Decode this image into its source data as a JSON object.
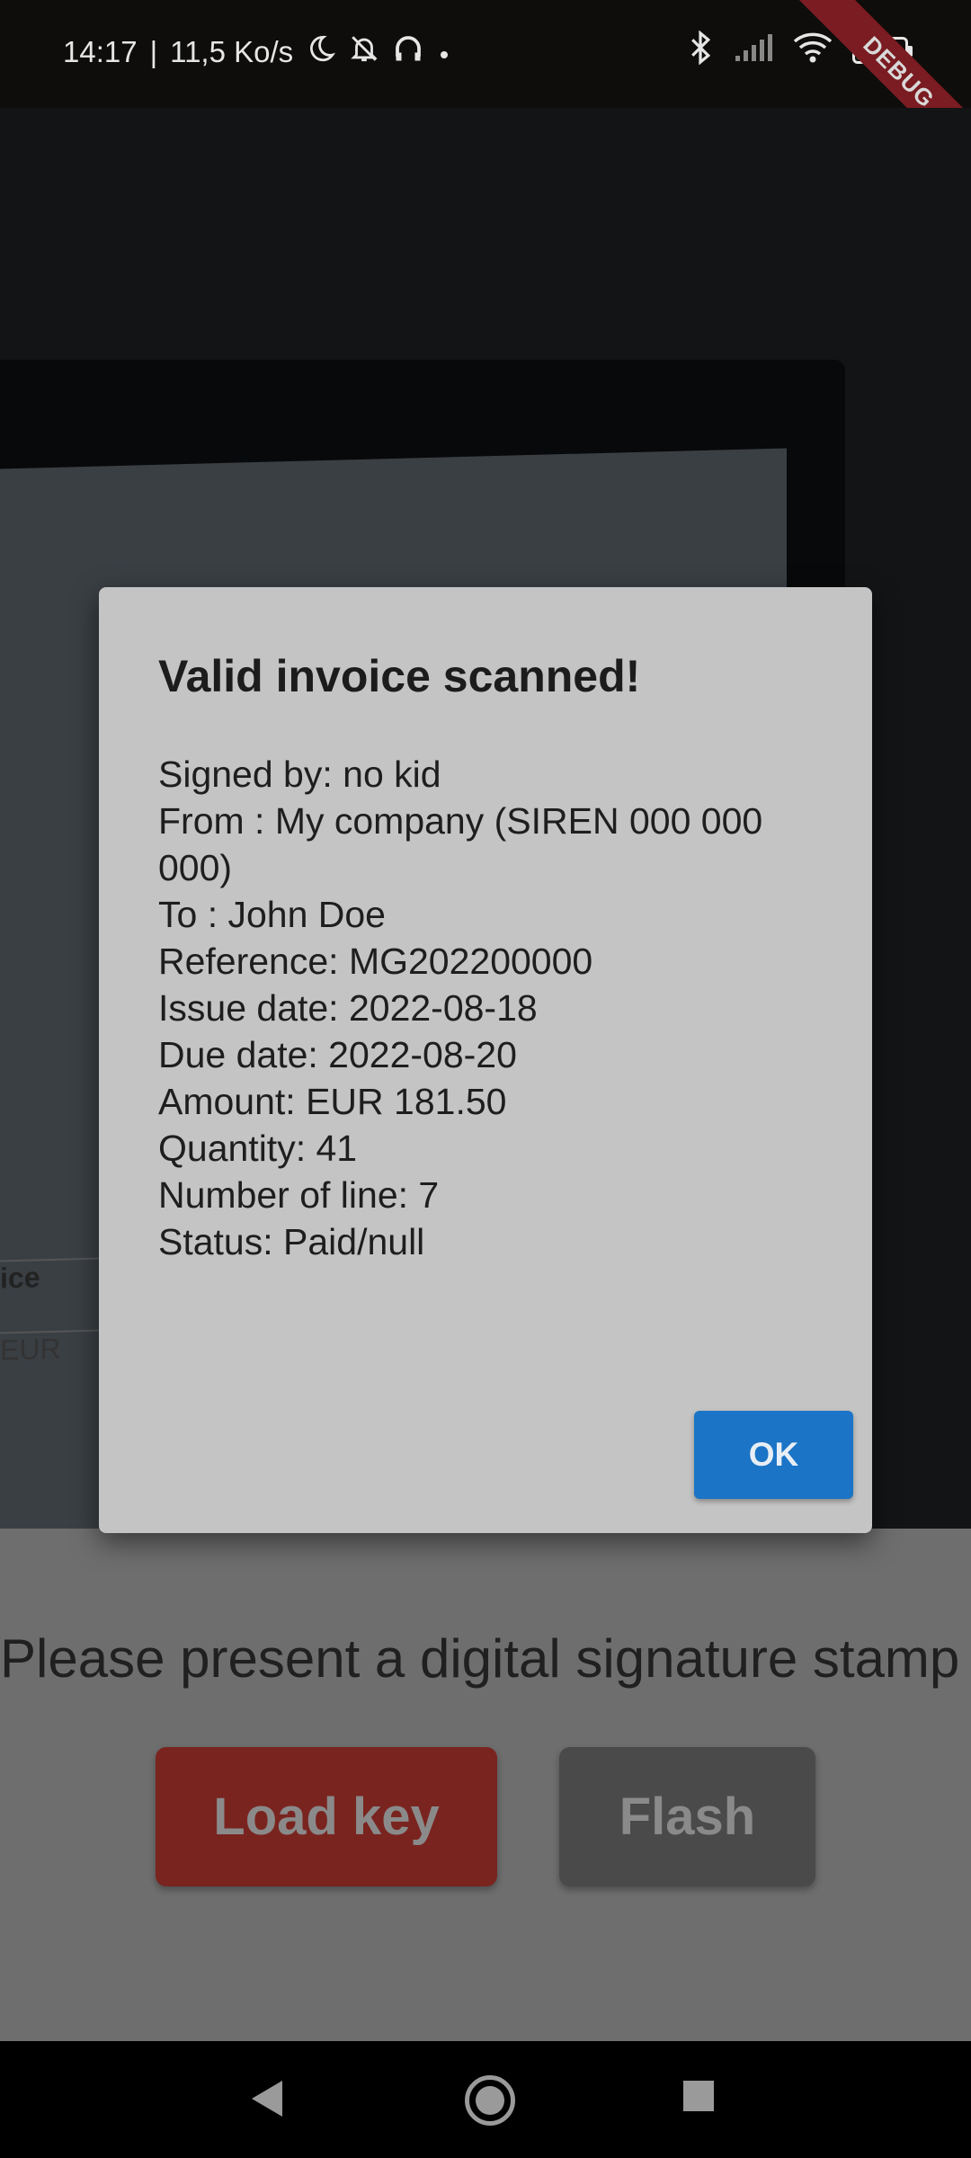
{
  "status_bar": {
    "time": "14:17",
    "speed": "11,5 Ko/s",
    "battery": "89"
  },
  "debug_banner": "DEBUG",
  "background_table": {
    "header": "ice",
    "cell": "EUR"
  },
  "dialog": {
    "title": "Valid invoice scanned!",
    "lines": [
      "Signed by: no kid",
      "From : My company (SIREN 000 000 000)",
      "To : John Doe",
      "Reference: MG202200000",
      "Issue date: 2022-08-18",
      "Due date: 2022-08-20",
      "Amount: EUR 181.50",
      "Quantity: 41",
      "Number of line: 7",
      "Status: Paid/null"
    ],
    "ok_label": "OK"
  },
  "panel": {
    "message": "Please present a digital signature stamp",
    "load_key_label": "Load key",
    "flash_label": "Flash"
  },
  "colors": {
    "ok_button": "#1b74c6",
    "load_key_button": "#7a2420",
    "flash_button": "#4a4a4a",
    "dialog_bg": "#c4c4c4"
  }
}
